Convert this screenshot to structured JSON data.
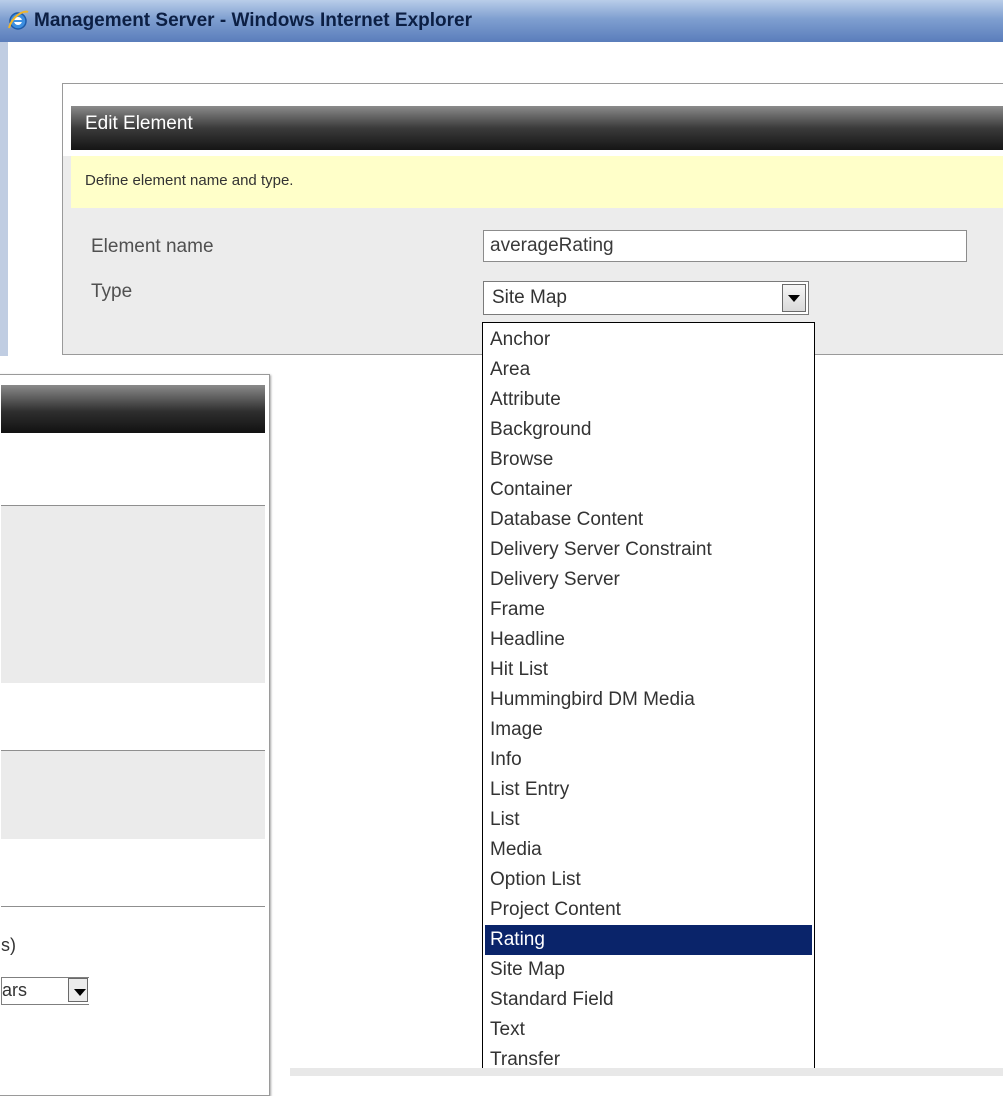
{
  "window": {
    "title": "Management Server - Windows Internet Explorer"
  },
  "dialog": {
    "heading": "Edit Element",
    "hint": "Define element name and type.",
    "element_name_label": "Element name",
    "element_name_value": "averageRating",
    "type_label": "Type",
    "type_selected": "Site Map"
  },
  "type_options": [
    "Anchor",
    "Area",
    "Attribute",
    "Background",
    "Browse",
    "Container",
    "Database Content",
    "Delivery Server Constraint",
    "Delivery Server",
    "Frame",
    "Headline",
    "Hit List",
    "Hummingbird DM Media",
    "Image",
    "Info",
    "List Entry",
    "List",
    "Media",
    "Option List",
    "Project Content",
    "Rating",
    "Site Map",
    "Standard Field",
    "Text",
    "Transfer"
  ],
  "highlighted_option": "Rating",
  "background_window": {
    "partial_text": "s)",
    "partial_select": "ars"
  },
  "colors": {
    "titlebar": "#7f9fd0",
    "selection": "#0a246a",
    "hint_bg": "#ffffc9"
  },
  "icons": {
    "browser": "ie-icon",
    "dropdown": "chevron-down-icon"
  }
}
